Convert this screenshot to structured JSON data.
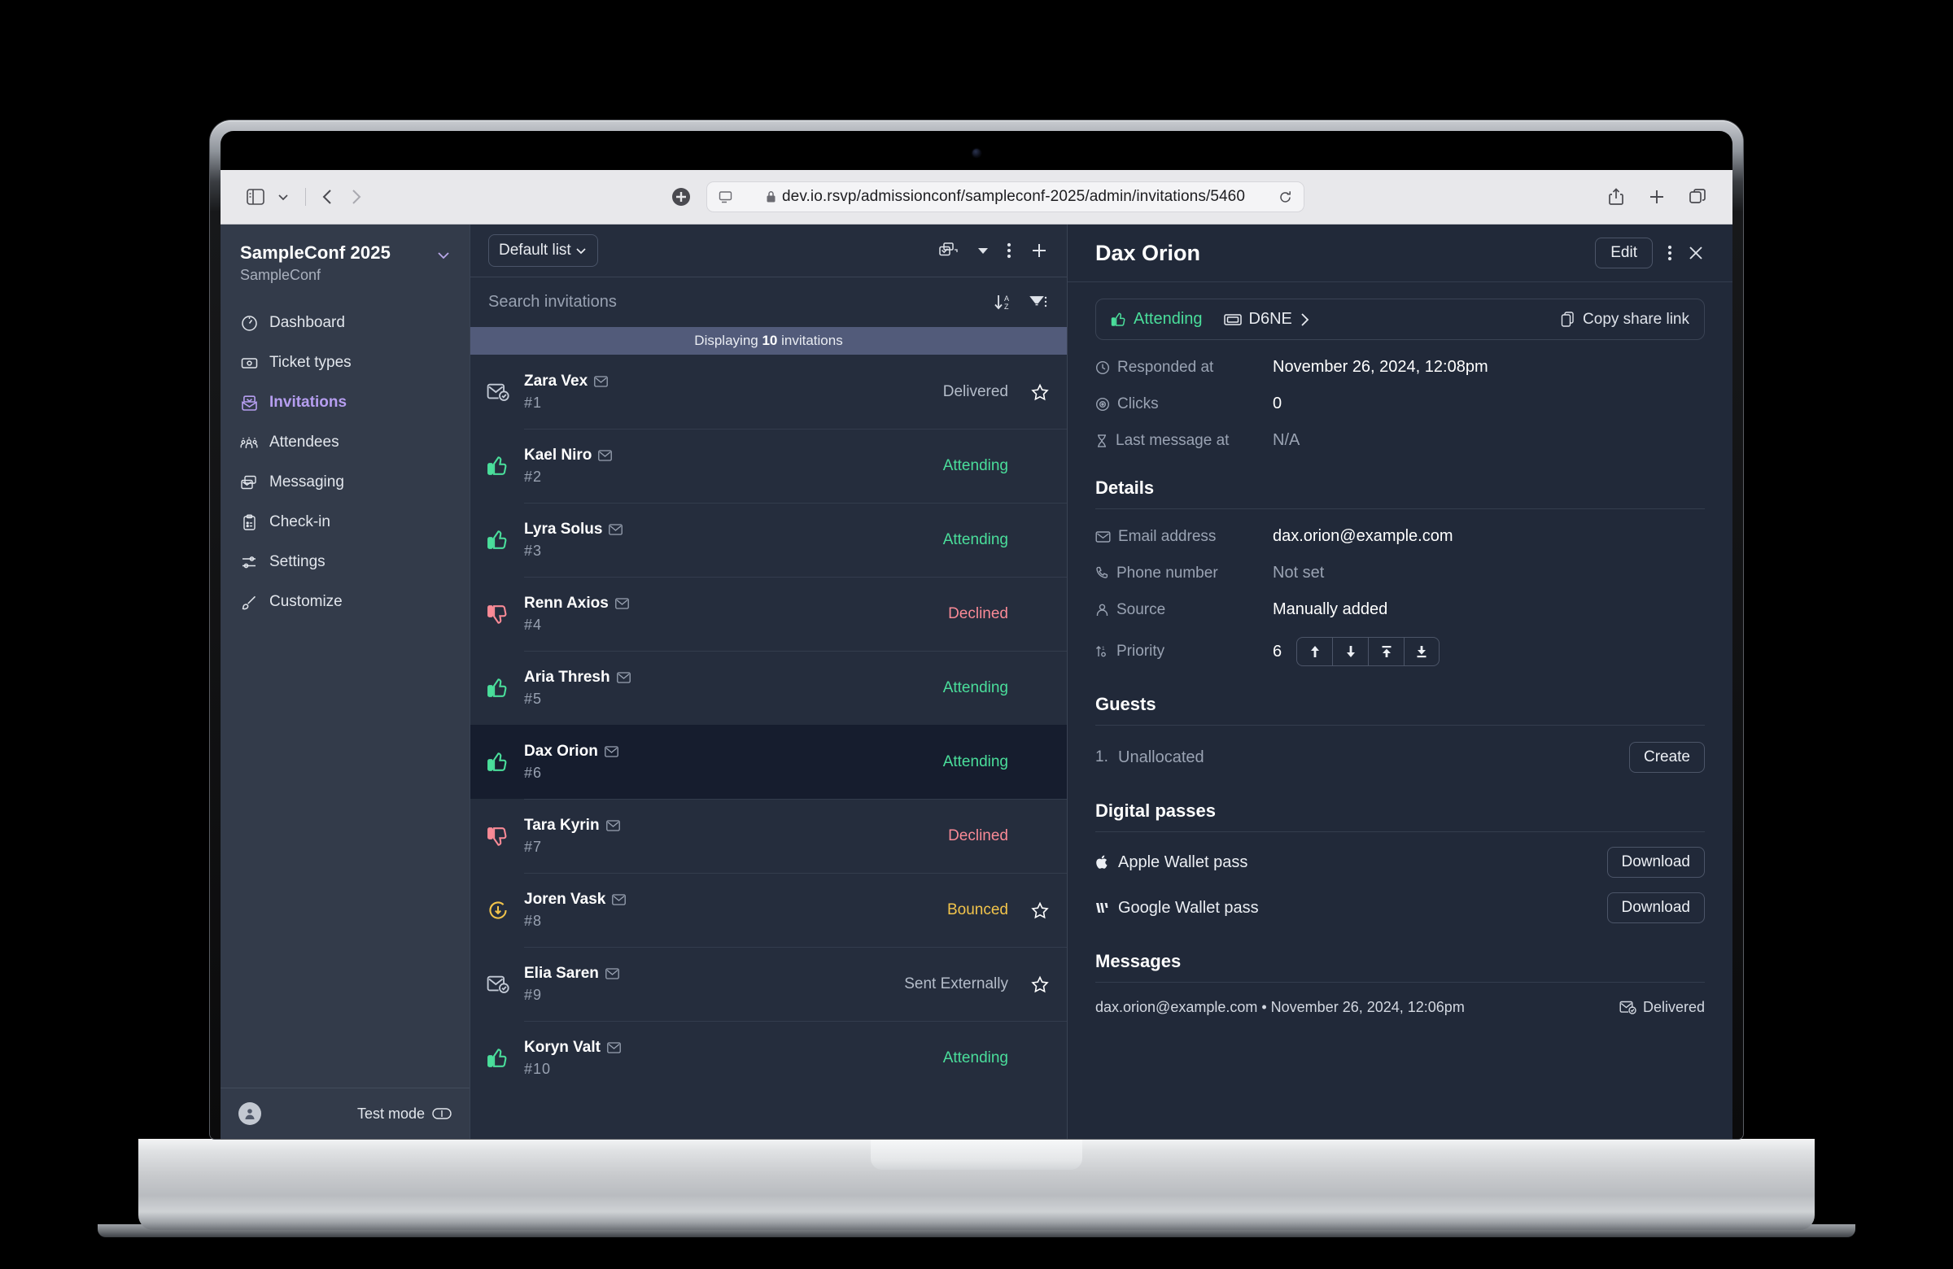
{
  "browser": {
    "url": "dev.io.rsvp/admissionconf/sampleconf-2025/admin/invitations/5460",
    "sidebar_toggle_icon": "sidebar-toggle-icon",
    "back_icon": "chevron-left-icon",
    "forward_icon": "chevron-right-icon",
    "share_icon": "share-icon",
    "newtab_icon": "plus-icon",
    "tabs_icon": "tab-overview-icon",
    "reload_icon": "reload-icon",
    "lock_icon": "lock-icon"
  },
  "sidebar": {
    "org_name": "SampleConf 2025",
    "org_sub": "SampleConf",
    "items": [
      {
        "label": "Dashboard",
        "icon": "gauge-icon",
        "active": false
      },
      {
        "label": "Ticket types",
        "icon": "ticket-icon",
        "active": false
      },
      {
        "label": "Invitations",
        "icon": "inbox-icon",
        "active": true
      },
      {
        "label": "Attendees",
        "icon": "people-icon",
        "active": false
      },
      {
        "label": "Messaging",
        "icon": "mail-stack-icon",
        "active": false
      },
      {
        "label": "Check-in",
        "icon": "clipboard-icon",
        "active": false
      },
      {
        "label": "Settings",
        "icon": "sliders-icon",
        "active": false
      },
      {
        "label": "Customize",
        "icon": "brush-icon",
        "active": false
      }
    ],
    "test_mode_label": "Test mode"
  },
  "list": {
    "select_label": "Default list",
    "search_placeholder": "Search invitations",
    "count_prefix": "Displaying ",
    "count": "10",
    "count_suffix": " invitations",
    "rows": [
      {
        "name": "Zara Vex",
        "num": "#1",
        "status": "Delivered",
        "status_class": "st-delivered",
        "icon": "mail-check-icon",
        "star": true,
        "selected": false
      },
      {
        "name": "Kael Niro",
        "num": "#2",
        "status": "Attending",
        "status_class": "st-attending",
        "icon": "thumbs-up-icon",
        "star": false,
        "selected": false
      },
      {
        "name": "Lyra Solus",
        "num": "#3",
        "status": "Attending",
        "status_class": "st-attending",
        "icon": "thumbs-up-icon",
        "star": false,
        "selected": false
      },
      {
        "name": "Renn Axios",
        "num": "#4",
        "status": "Declined",
        "status_class": "st-declined",
        "icon": "thumbs-down-icon",
        "star": false,
        "selected": false
      },
      {
        "name": "Aria Thresh",
        "num": "#5",
        "status": "Attending",
        "status_class": "st-attending",
        "icon": "thumbs-up-icon",
        "star": false,
        "selected": false
      },
      {
        "name": "Dax Orion",
        "num": "#6",
        "status": "Attending",
        "status_class": "st-attending",
        "icon": "thumbs-up-icon",
        "star": false,
        "selected": true
      },
      {
        "name": "Tara Kyrin",
        "num": "#7",
        "status": "Declined",
        "status_class": "st-declined",
        "icon": "thumbs-down-icon",
        "star": false,
        "selected": false
      },
      {
        "name": "Joren Vask",
        "num": "#8",
        "status": "Bounced",
        "status_class": "st-bounced",
        "icon": "bounce-icon",
        "star": true,
        "selected": false
      },
      {
        "name": "Elia Saren",
        "num": "#9",
        "status": "Sent Externally",
        "status_class": "st-sent",
        "icon": "mail-check-icon",
        "star": true,
        "selected": false
      },
      {
        "name": "Koryn Valt",
        "num": "#10",
        "status": "Attending",
        "status_class": "st-attending",
        "icon": "thumbs-up-icon",
        "star": false,
        "selected": false
      }
    ]
  },
  "detail": {
    "title": "Dax Orion",
    "edit_label": "Edit",
    "status_label": "Attending",
    "ticket_code": "D6NE",
    "share_label": "Copy share link",
    "meta": [
      {
        "label": "Responded at",
        "icon": "clock-icon",
        "value": "November 26, 2024, 12:08pm",
        "muted": false
      },
      {
        "label": "Clicks",
        "icon": "target-icon",
        "value": "0",
        "muted": false
      },
      {
        "label": "Last message at",
        "icon": "hourglass-icon",
        "value": "N/A",
        "muted": true
      }
    ],
    "details_title": "Details",
    "details": [
      {
        "label": "Email address",
        "icon": "envelope-icon",
        "value": "dax.orion@example.com",
        "muted": false
      },
      {
        "label": "Phone number",
        "icon": "phone-icon",
        "value": "Not set",
        "muted": true
      },
      {
        "label": "Source",
        "icon": "person-icon",
        "value": "Manually added",
        "muted": false
      }
    ],
    "priority_label": "Priority",
    "priority_icon": "sort-icon",
    "priority_value": "6",
    "priority_buttons": [
      "arrow-up-icon",
      "arrow-down-icon",
      "arrow-to-top-icon",
      "arrow-to-bottom-icon"
    ],
    "guests_title": "Guests",
    "guest_index": "1.",
    "guest_name": "Unallocated",
    "guest_create_label": "Create",
    "passes_title": "Digital passes",
    "passes": [
      {
        "label": "Apple Wallet pass",
        "icon": "apple-icon",
        "button": "Download"
      },
      {
        "label": "Google Wallet pass",
        "icon": "google-icon",
        "button": "Download"
      }
    ],
    "messages_title": "Messages",
    "message": {
      "text": "dax.orion@example.com • November 26, 2024, 12:06pm",
      "status": "Delivered",
      "status_icon": "mail-check-icon"
    }
  },
  "colors": {
    "accent": "#b69ef0",
    "attending": "#4ade9b",
    "declined": "#f98a96",
    "bounced": "#f2c44b",
    "sidebar_bg": "#333b4a",
    "list_bg": "#252d3d",
    "detail_bg": "#212939"
  }
}
